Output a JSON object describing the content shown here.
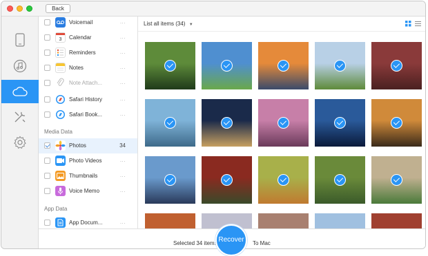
{
  "titlebar": {
    "back_label": "Back"
  },
  "iconbar": {
    "items": [
      "device-icon",
      "music-icon",
      "cloud-icon",
      "tools-icon",
      "gear-icon"
    ],
    "active": "cloud-icon"
  },
  "sidebar": {
    "rows": [
      {
        "label": "Voicemail",
        "icon": "voicemail-icon",
        "color": "#2a7de1",
        "checked": false,
        "meta": "..."
      },
      {
        "label": "Calendar",
        "icon": "calendar-icon",
        "color": "#ffffff",
        "checked": false,
        "meta": "..."
      },
      {
        "label": "Reminders",
        "icon": "reminders-icon",
        "color": "#ffffff",
        "checked": false,
        "meta": "..."
      },
      {
        "label": "Notes",
        "icon": "notes-icon",
        "color": "#f7c531",
        "checked": false,
        "meta": "..."
      },
      {
        "label": "Note Attach...",
        "icon": "paperclip-icon",
        "color": "#ffffff",
        "checked": false,
        "meta": "...",
        "dim": true
      },
      {
        "label": "Safari History",
        "icon": "safari-icon",
        "color": "#2a95f5",
        "checked": false,
        "meta": "..."
      },
      {
        "label": "Safari Book...",
        "icon": "safari-bookmark-icon",
        "color": "#2a95f5",
        "checked": false,
        "meta": "..."
      }
    ],
    "media_header": "Media Data",
    "media_rows": [
      {
        "label": "Photos",
        "icon": "photos-icon",
        "checked": true,
        "count": "34",
        "selected": true
      },
      {
        "label": "Photo Videos",
        "icon": "photo-videos-icon",
        "color": "#2a95f5",
        "checked": false,
        "meta": "..."
      },
      {
        "label": "Thumbnails",
        "icon": "thumbnails-icon",
        "color": "#f49a24",
        "checked": false,
        "meta": "..."
      },
      {
        "label": "Voice Memo",
        "icon": "voice-memo-icon",
        "color": "#c86bdc",
        "checked": false,
        "meta": "..."
      }
    ],
    "app_header": "App Data",
    "app_rows": [
      {
        "label": "App Docum...",
        "icon": "app-document-icon",
        "color": "#2a95f5",
        "checked": false,
        "meta": "..."
      }
    ]
  },
  "content": {
    "list_label": "List all items (34)",
    "photos": [
      {
        "name": "leaves",
        "c1": "#5e8b3a",
        "c2": "#1f3a1a",
        "checked": true
      },
      {
        "name": "green-field",
        "c1": "#4f8fd0",
        "c2": "#6aa84a",
        "checked": true
      },
      {
        "name": "sunset-sea",
        "c1": "#e58a3a",
        "c2": "#3a4a6a",
        "checked": true
      },
      {
        "name": "crop-field",
        "c1": "#b8d0e6",
        "c2": "#5e8a3a",
        "checked": true
      },
      {
        "name": "red-autumn",
        "c1": "#8a3a3a",
        "c2": "#4a2020",
        "checked": true
      },
      {
        "name": "lake-reflection",
        "c1": "#7fb3d8",
        "c2": "#3e6a8a",
        "checked": true
      },
      {
        "name": "night-shore",
        "c1": "#1a2a4a",
        "c2": "#c7a060",
        "checked": true
      },
      {
        "name": "cherry-blossom",
        "c1": "#c77fa8",
        "c2": "#6a3a5a",
        "checked": true
      },
      {
        "name": "ocean-horizon",
        "c1": "#2a5a9a",
        "c2": "#0a1a3a",
        "checked": true
      },
      {
        "name": "lone-tree",
        "c1": "#d08a3a",
        "c2": "#3a2a1a",
        "checked": true
      },
      {
        "name": "snowy-mountain",
        "c1": "#6a9acc",
        "c2": "#2a3a5a",
        "checked": true
      },
      {
        "name": "red-temple",
        "c1": "#8a2a20",
        "c2": "#3a4a2a",
        "checked": true
      },
      {
        "name": "fox",
        "c1": "#a8b04a",
        "c2": "#c07a30",
        "checked": true
      },
      {
        "name": "meerkat",
        "c1": "#6a8a3a",
        "c2": "#3a5a2a",
        "checked": true
      },
      {
        "name": "green-hills",
        "c1": "#c0b090",
        "c2": "#4a7a3a",
        "checked": true
      },
      {
        "name": "partial-1",
        "c1": "#c06030",
        "c2": "#803020",
        "checked": false
      },
      {
        "name": "partial-2",
        "c1": "#c0c0d0",
        "c2": "#9098b0",
        "checked": false
      },
      {
        "name": "partial-3",
        "c1": "#a88070",
        "c2": "#5a4a4a",
        "checked": false
      },
      {
        "name": "partial-4",
        "c1": "#a0c0e0",
        "c2": "#6a90c0",
        "checked": false
      },
      {
        "name": "partial-5",
        "c1": "#a04030",
        "c2": "#602020",
        "checked": false
      }
    ]
  },
  "footer": {
    "selected_text": "Selected 34 items",
    "recover_label": "Recover",
    "to_mac": "To Mac"
  },
  "colors": {
    "accent": "#2a95f5",
    "selected_row": "#e8f2fd"
  }
}
